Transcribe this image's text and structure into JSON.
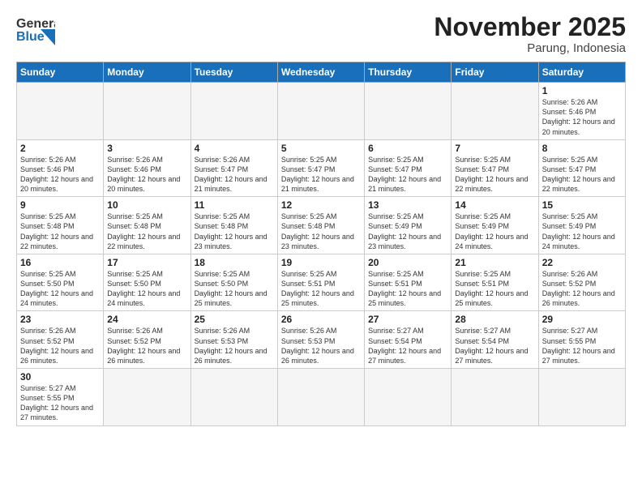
{
  "header": {
    "logo_general": "General",
    "logo_blue": "Blue",
    "month_title": "November 2025",
    "location": "Parung, Indonesia"
  },
  "weekdays": [
    "Sunday",
    "Monday",
    "Tuesday",
    "Wednesday",
    "Thursday",
    "Friday",
    "Saturday"
  ],
  "weeks": [
    [
      {
        "day": "",
        "empty": true
      },
      {
        "day": "",
        "empty": true
      },
      {
        "day": "",
        "empty": true
      },
      {
        "day": "",
        "empty": true
      },
      {
        "day": "",
        "empty": true
      },
      {
        "day": "",
        "empty": true
      },
      {
        "day": "1",
        "sunrise": "5:26 AM",
        "sunset": "5:46 PM",
        "daylight": "12 hours and 20 minutes."
      }
    ],
    [
      {
        "day": "2",
        "sunrise": "5:26 AM",
        "sunset": "5:46 PM",
        "daylight": "12 hours and 20 minutes."
      },
      {
        "day": "3",
        "sunrise": "5:26 AM",
        "sunset": "5:46 PM",
        "daylight": "12 hours and 20 minutes."
      },
      {
        "day": "4",
        "sunrise": "5:26 AM",
        "sunset": "5:47 PM",
        "daylight": "12 hours and 21 minutes."
      },
      {
        "day": "5",
        "sunrise": "5:25 AM",
        "sunset": "5:47 PM",
        "daylight": "12 hours and 21 minutes."
      },
      {
        "day": "6",
        "sunrise": "5:25 AM",
        "sunset": "5:47 PM",
        "daylight": "12 hours and 21 minutes."
      },
      {
        "day": "7",
        "sunrise": "5:25 AM",
        "sunset": "5:47 PM",
        "daylight": "12 hours and 22 minutes."
      },
      {
        "day": "8",
        "sunrise": "5:25 AM",
        "sunset": "5:47 PM",
        "daylight": "12 hours and 22 minutes."
      }
    ],
    [
      {
        "day": "9",
        "sunrise": "5:25 AM",
        "sunset": "5:48 PM",
        "daylight": "12 hours and 22 minutes."
      },
      {
        "day": "10",
        "sunrise": "5:25 AM",
        "sunset": "5:48 PM",
        "daylight": "12 hours and 22 minutes."
      },
      {
        "day": "11",
        "sunrise": "5:25 AM",
        "sunset": "5:48 PM",
        "daylight": "12 hours and 23 minutes."
      },
      {
        "day": "12",
        "sunrise": "5:25 AM",
        "sunset": "5:48 PM",
        "daylight": "12 hours and 23 minutes."
      },
      {
        "day": "13",
        "sunrise": "5:25 AM",
        "sunset": "5:49 PM",
        "daylight": "12 hours and 23 minutes."
      },
      {
        "day": "14",
        "sunrise": "5:25 AM",
        "sunset": "5:49 PM",
        "daylight": "12 hours and 24 minutes."
      },
      {
        "day": "15",
        "sunrise": "5:25 AM",
        "sunset": "5:49 PM",
        "daylight": "12 hours and 24 minutes."
      }
    ],
    [
      {
        "day": "16",
        "sunrise": "5:25 AM",
        "sunset": "5:50 PM",
        "daylight": "12 hours and 24 minutes."
      },
      {
        "day": "17",
        "sunrise": "5:25 AM",
        "sunset": "5:50 PM",
        "daylight": "12 hours and 24 minutes."
      },
      {
        "day": "18",
        "sunrise": "5:25 AM",
        "sunset": "5:50 PM",
        "daylight": "12 hours and 25 minutes."
      },
      {
        "day": "19",
        "sunrise": "5:25 AM",
        "sunset": "5:51 PM",
        "daylight": "12 hours and 25 minutes."
      },
      {
        "day": "20",
        "sunrise": "5:25 AM",
        "sunset": "5:51 PM",
        "daylight": "12 hours and 25 minutes."
      },
      {
        "day": "21",
        "sunrise": "5:25 AM",
        "sunset": "5:51 PM",
        "daylight": "12 hours and 25 minutes."
      },
      {
        "day": "22",
        "sunrise": "5:26 AM",
        "sunset": "5:52 PM",
        "daylight": "12 hours and 26 minutes."
      }
    ],
    [
      {
        "day": "23",
        "sunrise": "5:26 AM",
        "sunset": "5:52 PM",
        "daylight": "12 hours and 26 minutes."
      },
      {
        "day": "24",
        "sunrise": "5:26 AM",
        "sunset": "5:52 PM",
        "daylight": "12 hours and 26 minutes."
      },
      {
        "day": "25",
        "sunrise": "5:26 AM",
        "sunset": "5:53 PM",
        "daylight": "12 hours and 26 minutes."
      },
      {
        "day": "26",
        "sunrise": "5:26 AM",
        "sunset": "5:53 PM",
        "daylight": "12 hours and 26 minutes."
      },
      {
        "day": "27",
        "sunrise": "5:27 AM",
        "sunset": "5:54 PM",
        "daylight": "12 hours and 27 minutes."
      },
      {
        "day": "28",
        "sunrise": "5:27 AM",
        "sunset": "5:54 PM",
        "daylight": "12 hours and 27 minutes."
      },
      {
        "day": "29",
        "sunrise": "5:27 AM",
        "sunset": "5:55 PM",
        "daylight": "12 hours and 27 minutes."
      }
    ],
    [
      {
        "day": "30",
        "sunrise": "5:27 AM",
        "sunset": "5:55 PM",
        "daylight": "12 hours and 27 minutes."
      },
      {
        "day": "",
        "empty": true
      },
      {
        "day": "",
        "empty": true
      },
      {
        "day": "",
        "empty": true
      },
      {
        "day": "",
        "empty": true
      },
      {
        "day": "",
        "empty": true
      },
      {
        "day": "",
        "empty": true
      }
    ]
  ]
}
